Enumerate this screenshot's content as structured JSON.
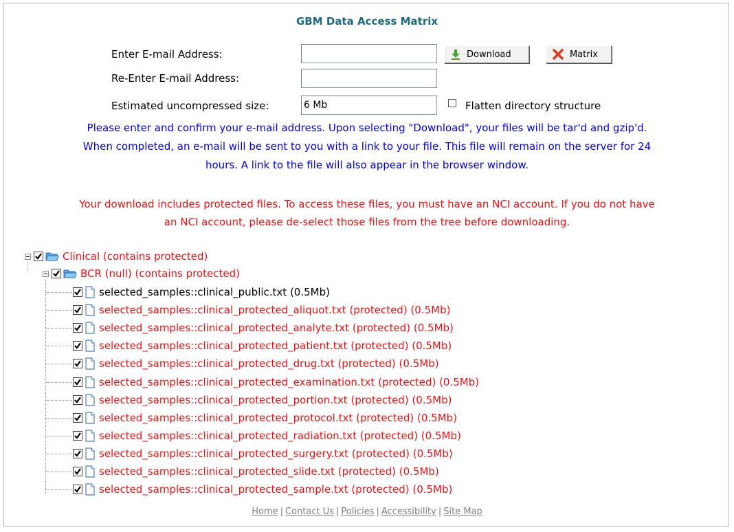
{
  "title": "GBM Data Access Matrix",
  "form": {
    "email_label": "Enter E-mail Address:",
    "email_value": "",
    "reenter_label": "Re-Enter E-mail Address:",
    "reenter_value": "",
    "size_label": "Estimated uncompressed size:",
    "size_value": "6 Mb",
    "flatten_label": "Flatten directory structure",
    "flatten_checked": false,
    "download_button": "Download",
    "matrix_button": "Matrix"
  },
  "info_lines": [
    "Please enter and confirm your e-mail address. Upon selecting \"Download\", your files will be tar'd and gzip'd.",
    "When completed, an e-mail will be sent to you with a link to your file. This file will remain on the server for 24",
    "hours. A link to the file will also appear in the browser window."
  ],
  "warning_lines": [
    "Your download includes protected files. To access these files, you must have an NCI account. If you do not have",
    "an NCI account, please de-select those files from the tree before downloading."
  ],
  "tree": {
    "root": {
      "label": "Clinical (contains protected)",
      "checked": true,
      "expanded": true
    },
    "child": {
      "label": "BCR (null) (contains protected)",
      "checked": true,
      "expanded": true
    },
    "files": [
      {
        "label": "selected_samples::clinical_public.txt (0.5Mb)",
        "protected": false,
        "checked": true
      },
      {
        "label": "selected_samples::clinical_protected_aliquot.txt (protected) (0.5Mb)",
        "protected": true,
        "checked": true
      },
      {
        "label": "selected_samples::clinical_protected_analyte.txt (protected) (0.5Mb)",
        "protected": true,
        "checked": true
      },
      {
        "label": "selected_samples::clinical_protected_patient.txt (protected) (0.5Mb)",
        "protected": true,
        "checked": true
      },
      {
        "label": "selected_samples::clinical_protected_drug.txt (protected) (0.5Mb)",
        "protected": true,
        "checked": true
      },
      {
        "label": "selected_samples::clinical_protected_examination.txt (protected) (0.5Mb)",
        "protected": true,
        "checked": true
      },
      {
        "label": "selected_samples::clinical_protected_portion.txt (protected) (0.5Mb)",
        "protected": true,
        "checked": true
      },
      {
        "label": "selected_samples::clinical_protected_protocol.txt (protected) (0.5Mb)",
        "protected": true,
        "checked": true
      },
      {
        "label": "selected_samples::clinical_protected_radiation.txt (protected) (0.5Mb)",
        "protected": true,
        "checked": true
      },
      {
        "label": "selected_samples::clinical_protected_surgery.txt (protected) (0.5Mb)",
        "protected": true,
        "checked": true
      },
      {
        "label": "selected_samples::clinical_protected_slide.txt (protected) (0.5Mb)",
        "protected": true,
        "checked": true
      },
      {
        "label": "selected_samples::clinical_protected_sample.txt (protected) (0.5Mb)",
        "protected": true,
        "checked": true
      }
    ]
  },
  "footer": {
    "links": [
      "Home",
      "Contact Us",
      "Policies",
      "Accessibility",
      "Site Map"
    ],
    "separator": "|"
  },
  "colors": {
    "title": "#1d6b80",
    "info_text": "#0000ee",
    "warning_text": "#ee1111",
    "footer_link": "#808080"
  }
}
